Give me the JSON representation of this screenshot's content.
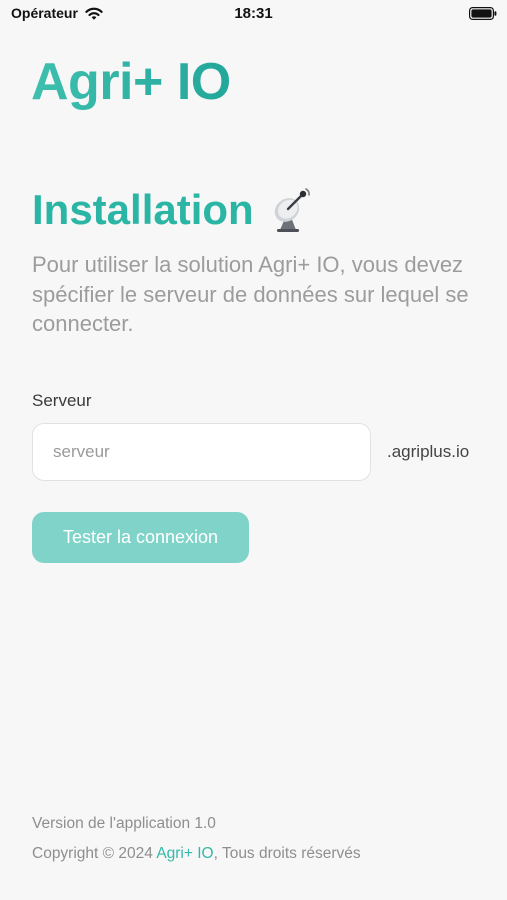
{
  "status_bar": {
    "carrier": "Opérateur",
    "time": "18:31"
  },
  "logo": {
    "text": "Agri+ IO"
  },
  "installation": {
    "title": "Installation",
    "description": "Pour utiliser la solution Agri+ IO, vous devez spécifier le serveur de données sur lequel se connecter."
  },
  "form": {
    "server_label": "Serveur",
    "server_value": "",
    "server_placeholder": "serveur",
    "domain_suffix": ".agriplus.io",
    "test_button_label": "Tester la connexion"
  },
  "footer": {
    "version_text": "Version de l'application 1.0",
    "copyright_prefix": "Copyright © 2024 ",
    "copyright_link": "Agri+ IO",
    "copyright_suffix": ", Tous droits réservés"
  },
  "icons": {
    "wifi": "wifi-icon",
    "battery": "battery-icon",
    "dish": "satellite-dish-icon"
  },
  "colors": {
    "brand": "#2bb5a5",
    "button": "#7fd3c9",
    "background": "#f7f7f7"
  }
}
